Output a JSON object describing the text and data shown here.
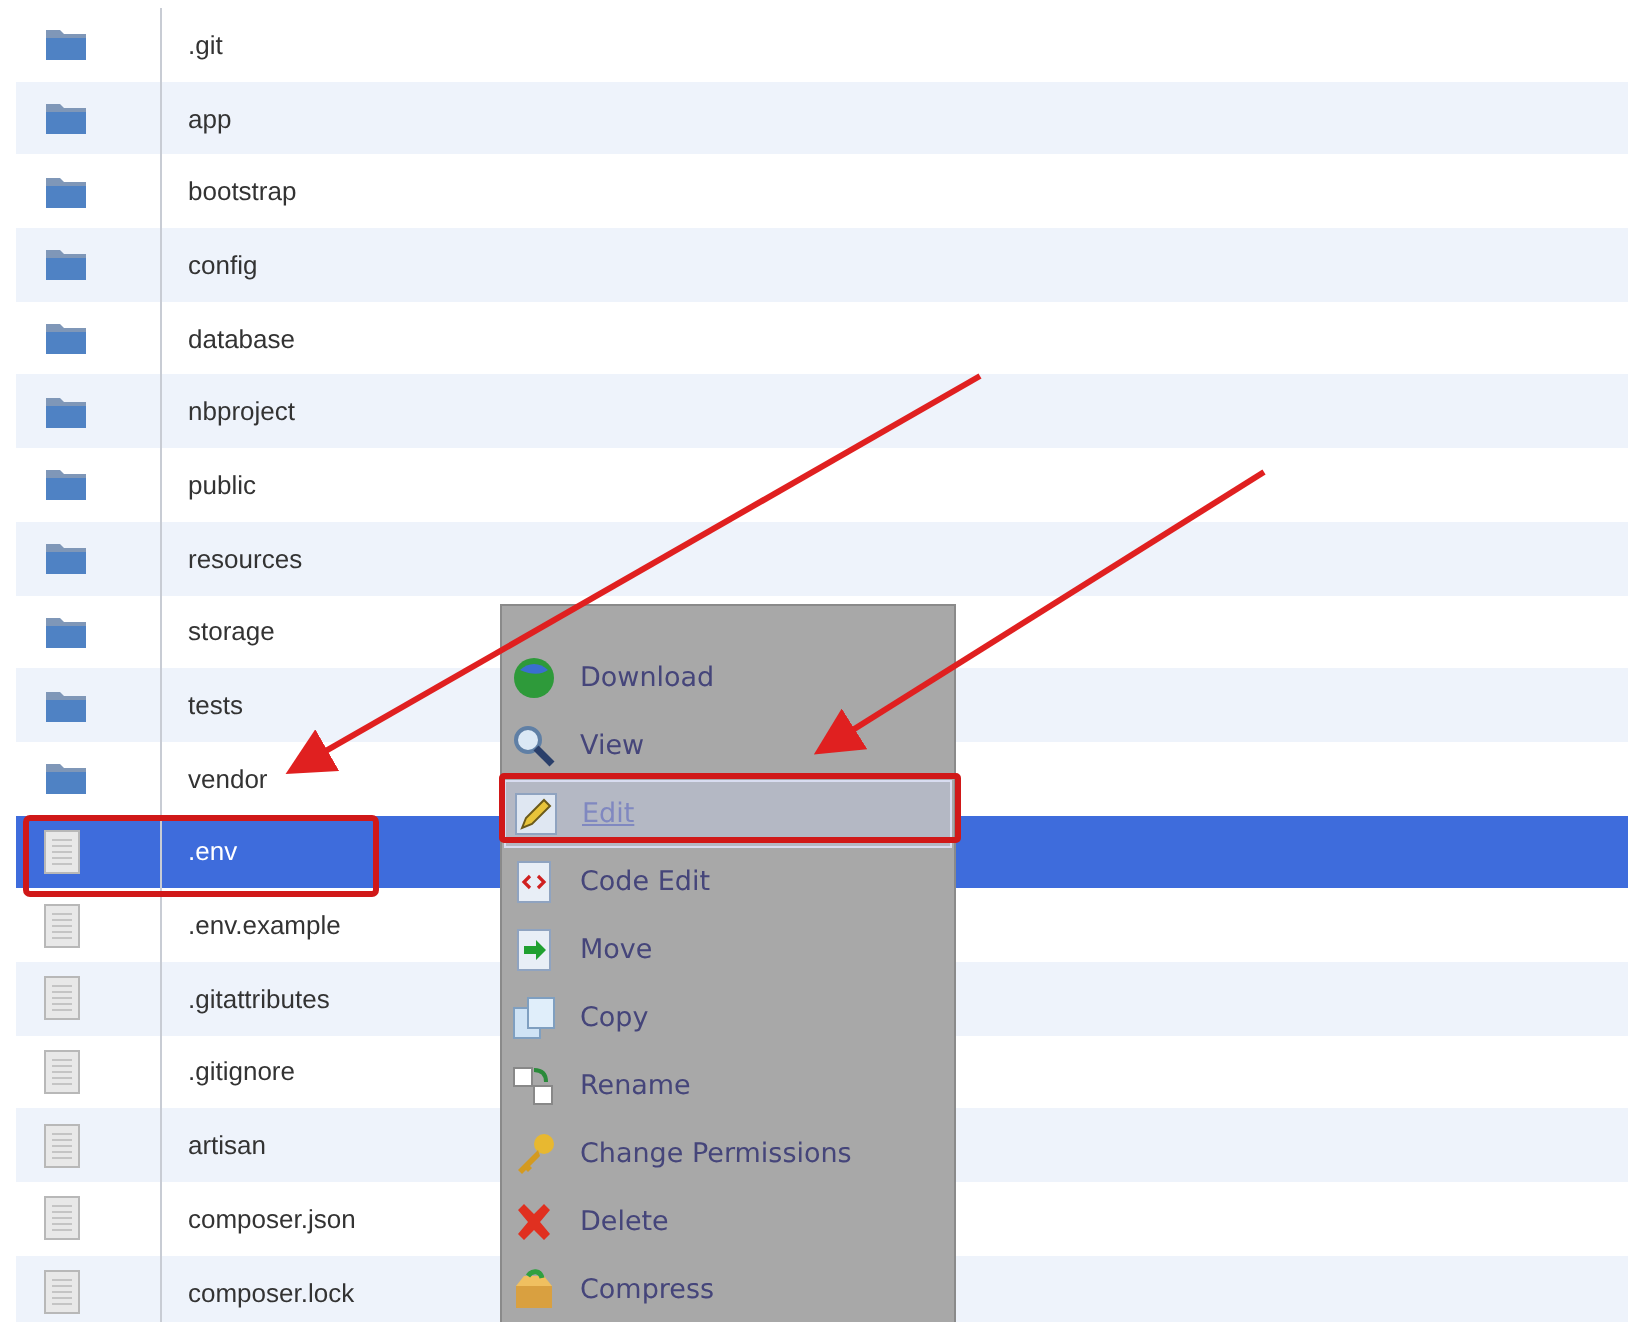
{
  "files": [
    {
      "name": ".git",
      "kind": "folder",
      "selected": false
    },
    {
      "name": "app",
      "kind": "folder",
      "selected": false
    },
    {
      "name": "bootstrap",
      "kind": "folder",
      "selected": false
    },
    {
      "name": "config",
      "kind": "folder",
      "selected": false
    },
    {
      "name": "database",
      "kind": "folder",
      "selected": false
    },
    {
      "name": "nbproject",
      "kind": "folder",
      "selected": false
    },
    {
      "name": "public",
      "kind": "folder",
      "selected": false
    },
    {
      "name": "resources",
      "kind": "folder",
      "selected": false
    },
    {
      "name": "storage",
      "kind": "folder",
      "selected": false
    },
    {
      "name": "tests",
      "kind": "folder",
      "selected": false
    },
    {
      "name": "vendor",
      "kind": "folder",
      "selected": false
    },
    {
      "name": ".env",
      "kind": "file",
      "selected": true
    },
    {
      "name": ".env.example",
      "kind": "file",
      "selected": false
    },
    {
      "name": ".gitattributes",
      "kind": "file",
      "selected": false
    },
    {
      "name": ".gitignore",
      "kind": "file",
      "selected": false
    },
    {
      "name": "artisan",
      "kind": "file",
      "selected": false
    },
    {
      "name": "composer.json",
      "kind": "file",
      "selected": false
    },
    {
      "name": "composer.lock",
      "kind": "file",
      "selected": false
    }
  ],
  "context_menu": [
    {
      "label": "Download",
      "disabled": false,
      "selected": false
    },
    {
      "label": "View",
      "disabled": false,
      "selected": false
    },
    {
      "label": "Edit",
      "disabled": true,
      "selected": true
    },
    {
      "label": "Code Edit",
      "disabled": false,
      "selected": false
    },
    {
      "label": "Move",
      "disabled": false,
      "selected": false
    },
    {
      "label": "Copy",
      "disabled": false,
      "selected": false
    },
    {
      "label": "Rename",
      "disabled": false,
      "selected": false
    },
    {
      "label": "Change Permissions",
      "disabled": false,
      "selected": false
    },
    {
      "label": "Delete",
      "disabled": false,
      "selected": false
    },
    {
      "label": "Compress",
      "disabled": false,
      "selected": false
    }
  ]
}
